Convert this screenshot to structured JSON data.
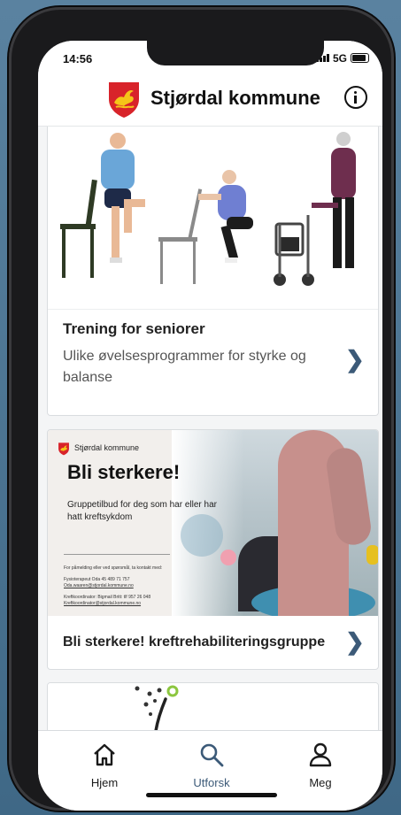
{
  "status_bar": {
    "time": "14:56",
    "network": "5G"
  },
  "header": {
    "title": "Stjørdal kommune",
    "info_icon": "info-icon",
    "logo": "coat-of-arms-logo"
  },
  "cards": [
    {
      "title": "Trening for seniorer",
      "description": "Ulike øvelsesprogrammer for styrke og balanse",
      "image": "seniors-exercise-illustration"
    },
    {
      "title": "Bli sterkere! kreftrehabiliteringsgruppe",
      "image": "flyer-image",
      "flyer": {
        "brand": "Stjørdal kommune",
        "title": "Bli sterkere!",
        "subtitle": "Gruppetilbud for deg som har eller har hatt kreftsykdom",
        "contact_lines": [
          "For påmelding eller ved spørsmål, ta kontakt med:",
          "Fysioterapeut Oda 45 489 71 757",
          "Oda.waaren@stjordal.kommune.no",
          "Kreftkoordinator: Bigmail Britt: tlf 957 26 048",
          "Kreftkoordinator@stjordal.kommune.no"
        ]
      }
    },
    {
      "title": "",
      "image": "abstract-plant-illustration"
    }
  ],
  "tabbar": {
    "items": [
      {
        "label": "Hjem",
        "icon": "home-icon",
        "active": false
      },
      {
        "label": "Utforsk",
        "icon": "search-icon",
        "active": true
      },
      {
        "label": "Meg",
        "icon": "person-icon",
        "active": false
      }
    ]
  },
  "colors": {
    "accent": "#3c5a78",
    "background": "#f4f5f6",
    "card": "#ffffff",
    "border": "#d9dcdf"
  }
}
